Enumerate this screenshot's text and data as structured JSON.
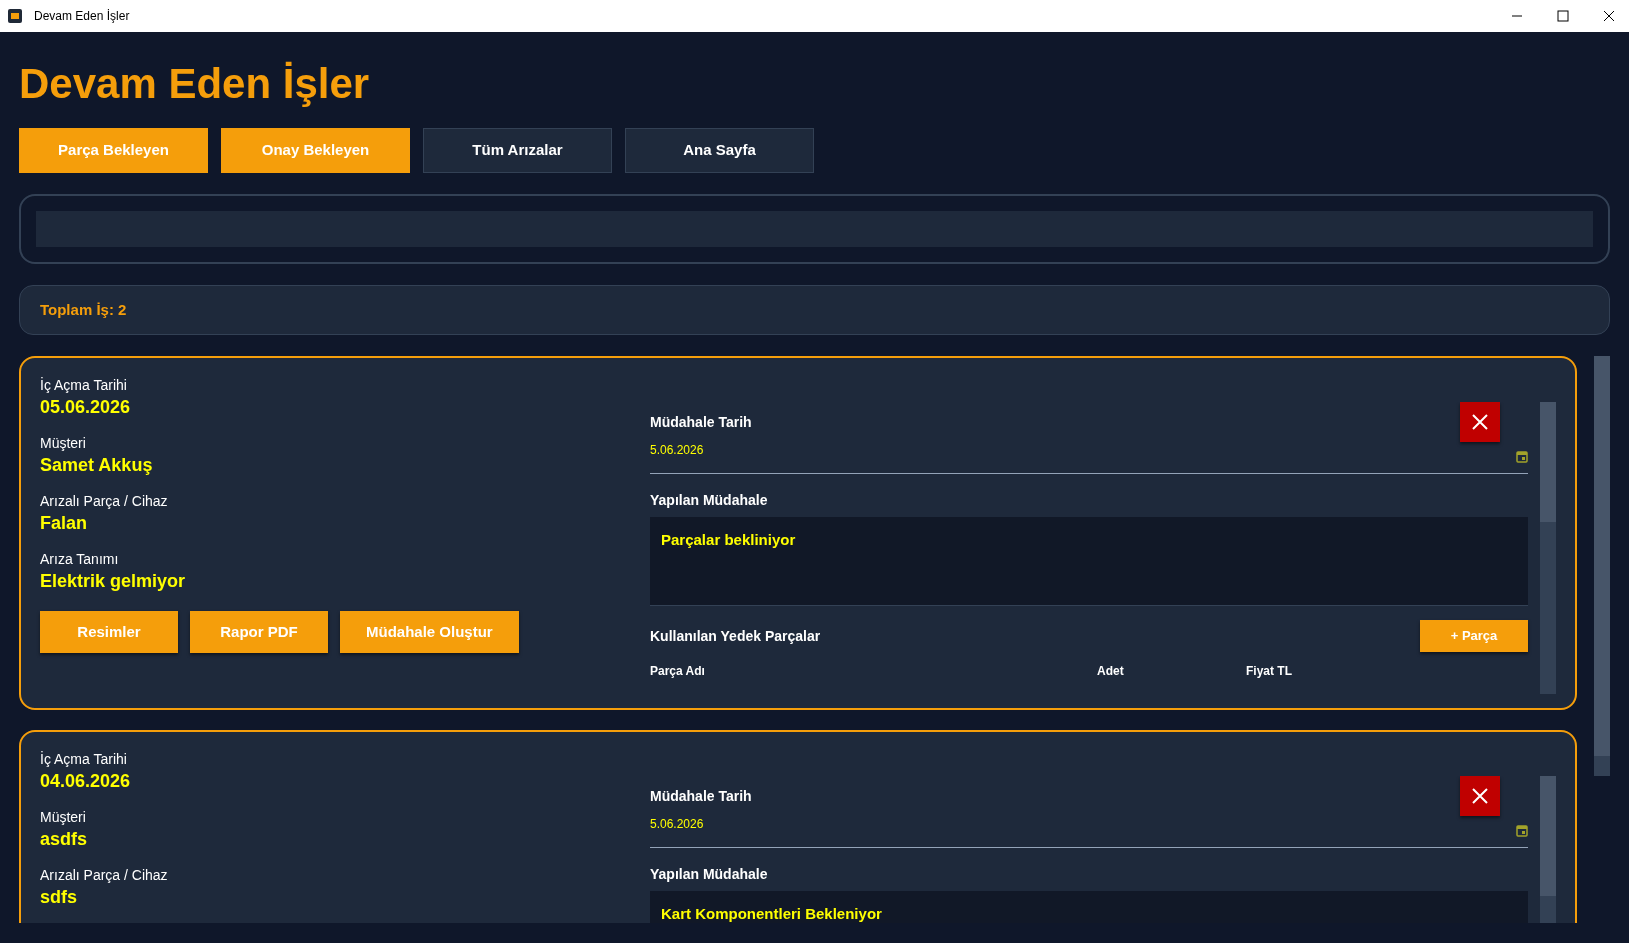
{
  "window": {
    "title": "Devam Eden İşler"
  },
  "heading": "Devam Eden İşler",
  "nav_buttons": [
    {
      "label": "Parça Bekleyen",
      "selected": true
    },
    {
      "label": "Onay Bekleyen",
      "selected": true
    },
    {
      "label": "Tüm Arızalar",
      "selected": false
    },
    {
      "label": "Ana Sayfa",
      "selected": false
    }
  ],
  "summary": "Toplam İş: 2",
  "jobs": [
    {
      "fields": [
        {
          "label": "İç Açma Tarihi",
          "value": "05.06.2026"
        },
        {
          "label": "Müşteri",
          "value": "Samet Akkuş"
        },
        {
          "label": "Arızalı Parça / Cihaz",
          "value": "Falan"
        },
        {
          "label": "Arıza Tanımı",
          "value": "Elektrik gelmiyor"
        }
      ],
      "actions": [
        "Resimler",
        "Rapor PDF",
        "Müdahale Oluştur"
      ],
      "intervention_date_label": "Müdahale Tarih",
      "intervention_date": "5.06.2026",
      "intervention_label": "Yapılan Müdahale",
      "intervention": "Parçalar bekliniyor",
      "parts": {
        "title": "Kullanılan Yedek Parçalar",
        "add_button": "+ Parça",
        "columns": [
          "Parça Adı",
          "Adet",
          "Fiyat TL"
        ]
      }
    },
    {
      "fields": [
        {
          "label": "İç Açma Tarihi",
          "value": "04.06.2026"
        },
        {
          "label": "Müşteri",
          "value": "asdfs"
        },
        {
          "label": "Arızalı Parça / Cihaz",
          "value": "sdfs"
        }
      ],
      "intervention_date_label": "Müdahale Tarih",
      "intervention_date": "5.06.2026",
      "intervention_label": "Yapılan Müdahale",
      "intervention": "Kart Komponentleri Bekleniyor"
    }
  ]
}
